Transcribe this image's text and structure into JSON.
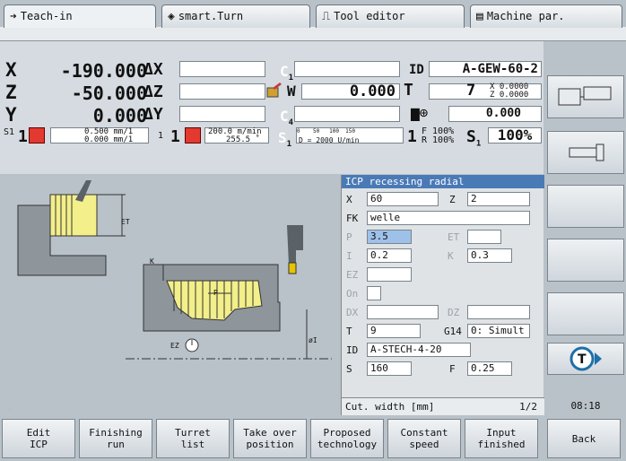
{
  "tabs": [
    {
      "label": "Teach-in",
      "icon": "arrow-right-icon"
    },
    {
      "label": "smart.Turn",
      "icon": "diamond-arrow-icon"
    },
    {
      "label": "Tool editor",
      "icon": "tool-icon"
    },
    {
      "label": "Machine par.",
      "icon": "machine-icon"
    }
  ],
  "pos": {
    "x": {
      "axis": "X",
      "value": "-190.000",
      "delta": "ΔX"
    },
    "z": {
      "axis": "Z",
      "value": "-50.000",
      "delta": "ΔZ"
    },
    "y": {
      "axis": "Y",
      "value": "0.000",
      "delta": "ΔY"
    },
    "c1": "C",
    "c1sub": "1",
    "c4": "C",
    "c4sub": "4",
    "w_label": "W",
    "w_value": "0.000",
    "id_label": "ID",
    "id_value": "A-GEW-60-2",
    "t_label": "T",
    "t_value": "7",
    "tx": "X  0.0000",
    "tz": "Z  0.0000",
    "spindle_val": "0.000",
    "s1": "S1",
    "feed1": "0.500 mm/1",
    "feed2": "0.000 mm/1",
    "one_a": "1",
    "one_b": "1",
    "speed1": "200.0 m/min",
    "speed2": "255.5 ˚",
    "s1b": "S",
    "s1bsub": "1",
    "scale": "0    50   100  150",
    "d_line": "D = 2000 U/min",
    "pct_one": "1",
    "f_pct": "F 100%",
    "r_pct": "R 100%",
    "s_pct_label": "S",
    "s_pct_sub": "1",
    "s_pct": "100%",
    "et_label": "ET",
    "k_label": "K",
    "p_label": "P",
    "ez_label": "EZ",
    "oi_label": "øI"
  },
  "dialog": {
    "title": "ICP recessing radial",
    "x_label": "X",
    "x_val": "60",
    "z_label": "Z",
    "z_val": "2",
    "fk_label": "FK",
    "fk_val": "welle",
    "p_label": "P",
    "p_val": "3.5",
    "et_label": "ET",
    "et_val": "",
    "i_label": "I",
    "i_val": "0.2",
    "k_label": "K",
    "k_val": "0.3",
    "ez_label": "EZ",
    "ez_val": "",
    "on_label": "On",
    "dx_label": "DX",
    "dx_val": "",
    "dz_label": "DZ",
    "dz_val": "",
    "t_label": "T",
    "t_val": "9",
    "g14_label": "G14",
    "g14_val": "0: Simult",
    "id_label": "ID",
    "id_val": "A-STECH-4-20",
    "s_label": "S",
    "s_val": "160",
    "f_label": "F",
    "f_val": "0.25",
    "status": "Cut. width [mm]",
    "page": "1/2"
  },
  "time": "08:18",
  "softkeys": [
    "Edit\nICP",
    "Finishing\nrun",
    "Turret\nlist",
    "Take over\nposition",
    "Proposed\ntechnology",
    "Constant\nspeed",
    "Input\nfinished",
    "Back"
  ],
  "colors": {
    "dialog_title": "#4a7ab6",
    "selected_field": "#9ec1ea",
    "contour_fill": "#f3ef8a",
    "tool": "#e8c400"
  }
}
